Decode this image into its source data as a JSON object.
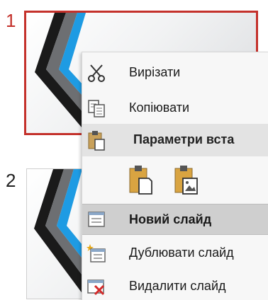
{
  "slides": [
    {
      "number": "1",
      "selected": true
    },
    {
      "number": "2",
      "selected": false
    }
  ],
  "context_menu": {
    "items": [
      {
        "label": "Вирізати",
        "icon": "cut-icon"
      },
      {
        "label": "Копіювати",
        "icon": "copy-icon"
      }
    ],
    "paste_section": {
      "label": "Параметри вста",
      "icon": "paste-icon",
      "options": [
        "paste-keep-formatting-icon",
        "paste-picture-icon"
      ]
    },
    "items2": [
      {
        "label": "Новий слайд",
        "icon": "new-slide-icon",
        "highlighted": true
      },
      {
        "label": "Дублювати слайд",
        "icon": "duplicate-slide-icon"
      },
      {
        "label": "Видалити слайд",
        "icon": "delete-slide-icon"
      }
    ]
  },
  "colors": {
    "selection_border": "#c4312b",
    "accent_blue": "#1e9be3",
    "dark_stripe": "#2b2b2b"
  }
}
